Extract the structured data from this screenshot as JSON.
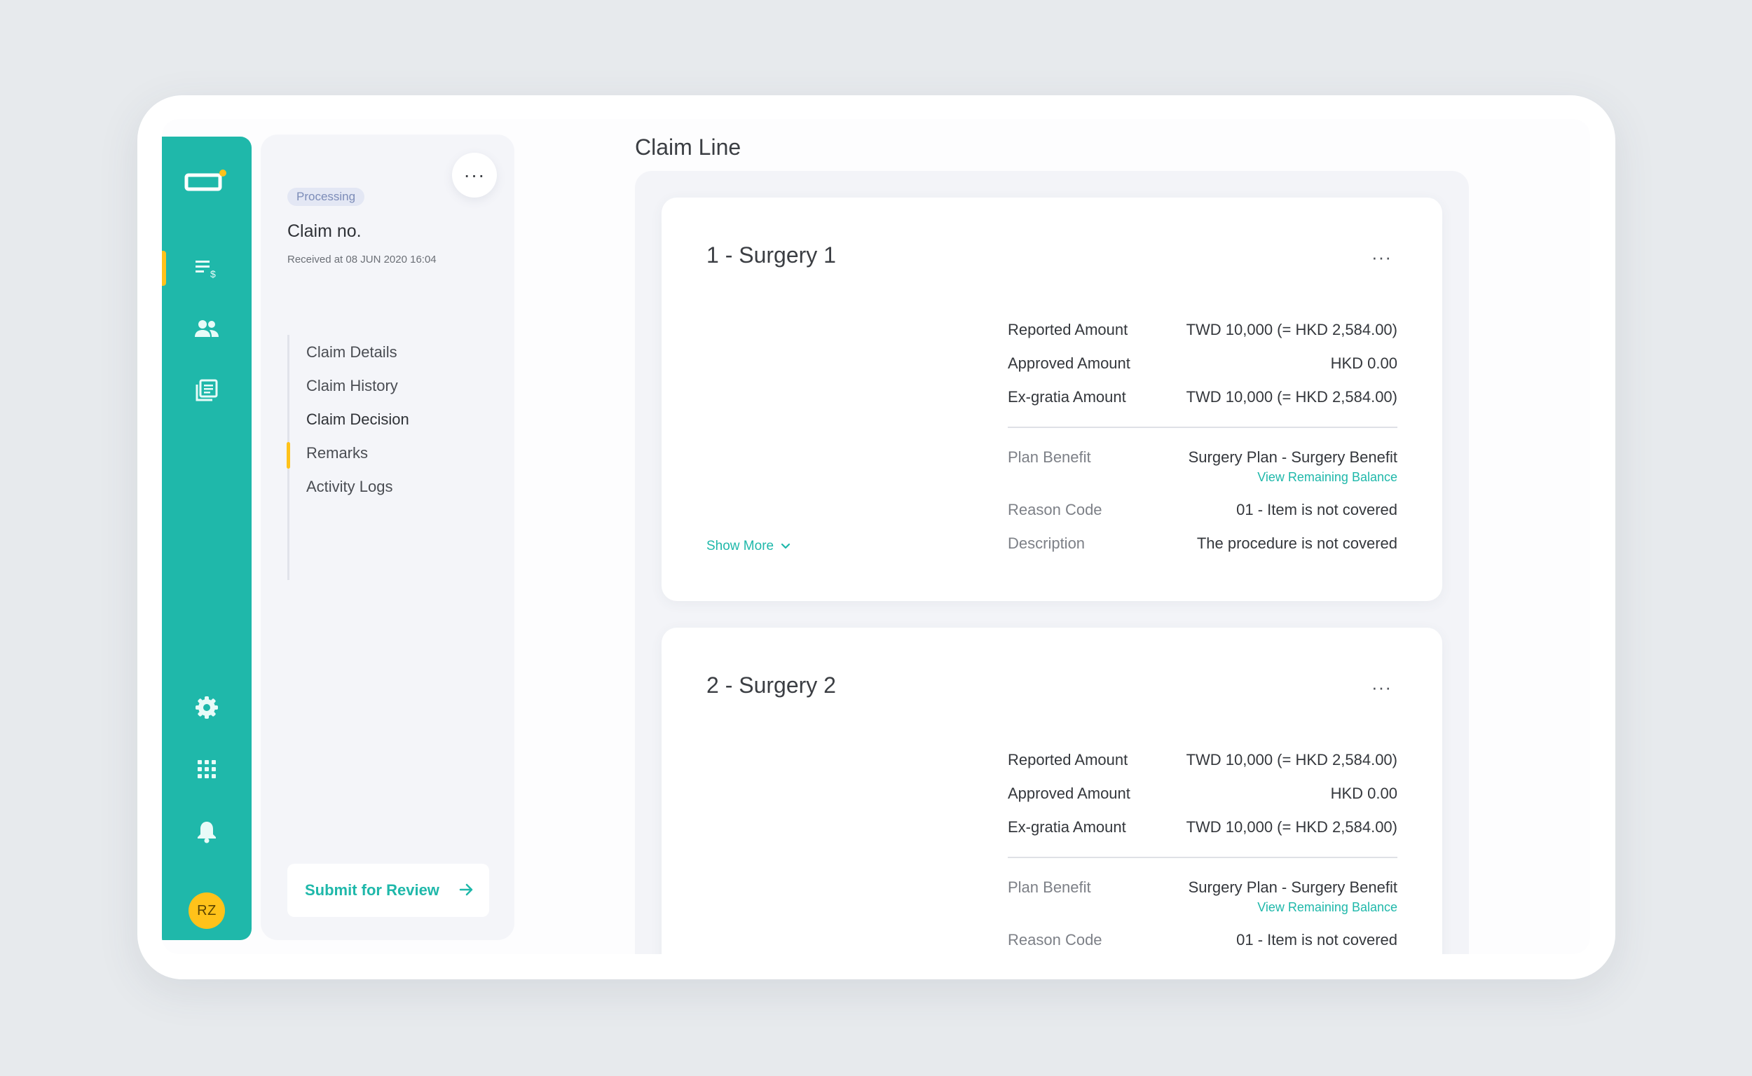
{
  "user": {
    "initials": "RZ"
  },
  "claim": {
    "status": "Processing",
    "number_label": "Claim no.",
    "received": "Received at 08 JUN 2020 16:04",
    "nav": [
      {
        "label": "Claim Details",
        "active": false
      },
      {
        "label": "Claim History",
        "active": false
      },
      {
        "label": "Claim Decision",
        "active": true
      },
      {
        "label": "Remarks",
        "active": false
      },
      {
        "label": "Activity Logs",
        "active": false
      }
    ],
    "submit_label": "Submit for Review"
  },
  "main": {
    "title": "Claim Line",
    "show_more_label": "Show More",
    "cards": [
      {
        "title": "1 - Surgery 1",
        "reported_label": "Reported Amount",
        "reported_value": "TWD 10,000 (= HKD 2,584.00)",
        "approved_label": "Approved Amount",
        "approved_value": "HKD 0.00",
        "exgratia_label": "Ex-gratia Amount",
        "exgratia_value": "TWD 10,000 (= HKD 2,584.00)",
        "plan_label": "Plan Benefit",
        "plan_value": "Surgery Plan - Surgery Benefit",
        "balance_link": "View Remaining Balance",
        "reason_label": "Reason Code",
        "reason_value": "01 - Item is not covered",
        "description_label": "Description",
        "description_value": "The procedure is not covered"
      },
      {
        "title": "2 - Surgery 2",
        "reported_label": "Reported Amount",
        "reported_value": "TWD 10,000 (= HKD 2,584.00)",
        "approved_label": "Approved Amount",
        "approved_value": "HKD 0.00",
        "exgratia_label": "Ex-gratia Amount",
        "exgratia_value": "TWD 10,000 (= HKD 2,584.00)",
        "plan_label": "Plan Benefit",
        "plan_value": "Surgery Plan - Surgery Benefit",
        "balance_link": "View Remaining Balance",
        "reason_label": "Reason Code",
        "reason_value": "01 - Item is not covered"
      }
    ]
  },
  "colors": {
    "primary": "#1fb8aa",
    "accent": "#ffc21a",
    "badge_bg": "#e3e7f4",
    "badge_text": "#7c8cb8"
  },
  "icons": [
    "app-logo-icon",
    "claims-icon",
    "members-icon",
    "documents-icon",
    "settings-icon",
    "apps-grid-icon",
    "bell-icon",
    "more-horizontal-icon",
    "arrow-right-icon",
    "chevron-down-icon"
  ]
}
